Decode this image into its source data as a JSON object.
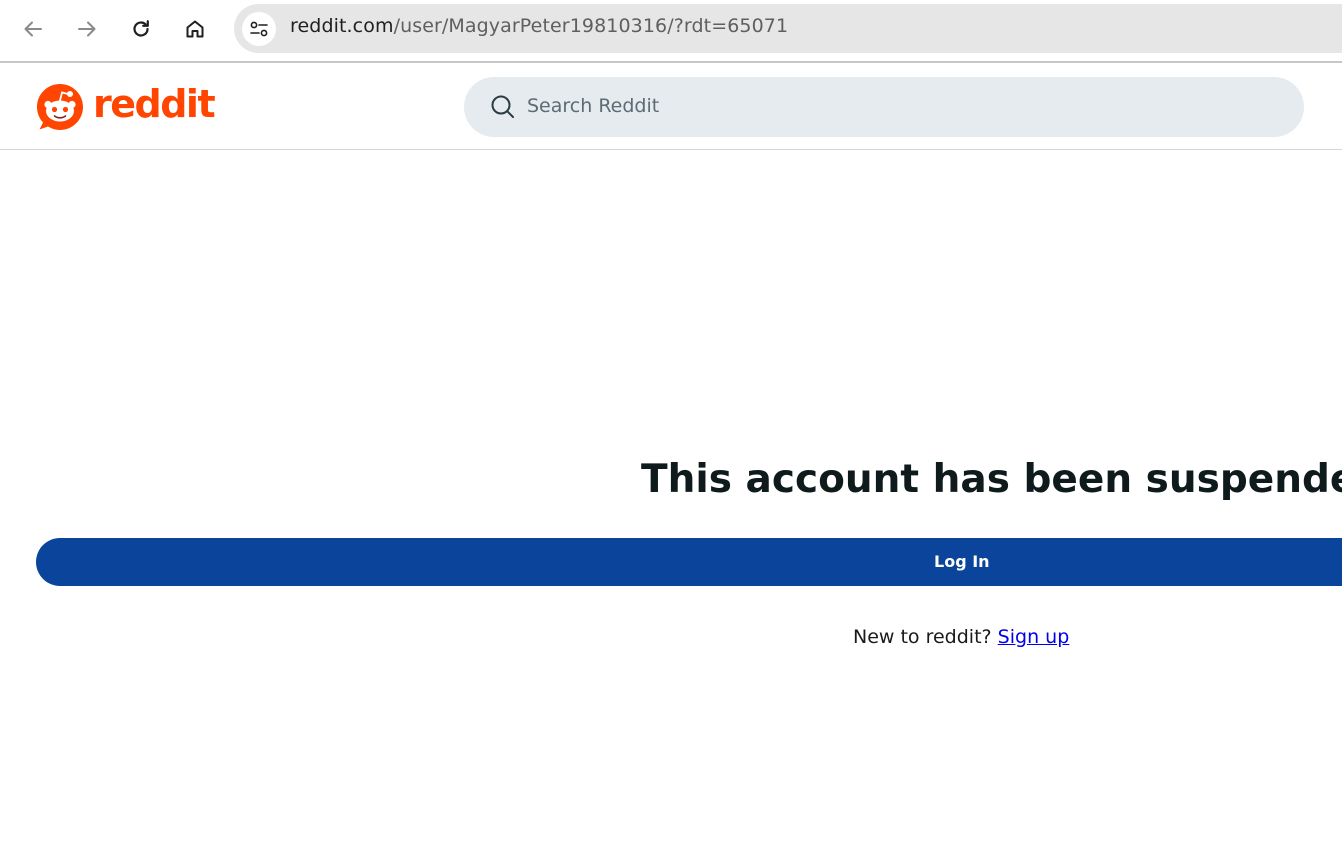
{
  "browser": {
    "url_domain": "reddit.com",
    "url_path": "/user/MagyarPeter19810316/?rdt=65071"
  },
  "header": {
    "logo_text": "reddit",
    "search_placeholder": "Search Reddit"
  },
  "main": {
    "title": "This account has been suspended",
    "login_label": "Log In",
    "signup_prompt": "New to reddit?",
    "signup_link": "Sign up"
  },
  "colors": {
    "brand": "#ff4500",
    "login_button": "#0a449b",
    "search_bg": "#e5ebee",
    "link": "#0000ee"
  }
}
